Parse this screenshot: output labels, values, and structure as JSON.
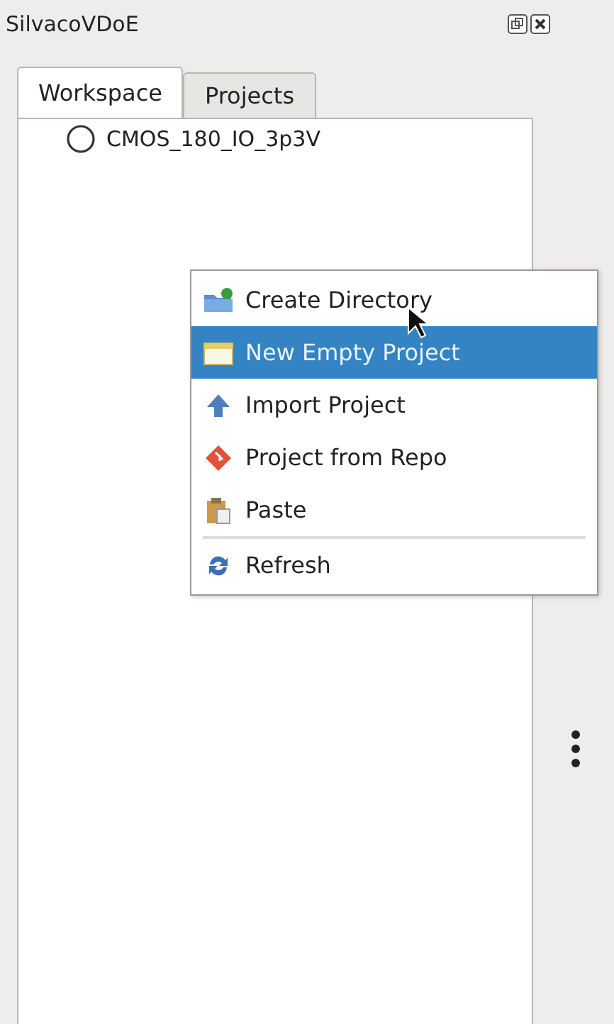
{
  "window": {
    "title": "SilvacoVDoE"
  },
  "tabs": [
    {
      "label": "Workspace",
      "selected": true
    },
    {
      "label": "Projects",
      "selected": false
    }
  ],
  "tree": {
    "items": [
      {
        "label": "CMOS_180_IO_3p3V",
        "selected": false
      }
    ]
  },
  "context_menu": {
    "items": [
      {
        "kind": "item",
        "label": "Create Directory",
        "selected": false
      },
      {
        "kind": "item",
        "label": "New Empty Project",
        "selected": true
      },
      {
        "kind": "item",
        "label": "Import Project",
        "selected": false
      },
      {
        "kind": "item",
        "label": "Project from Repo",
        "selected": false
      },
      {
        "kind": "item",
        "label": "Paste",
        "selected": false
      },
      {
        "kind": "separator"
      },
      {
        "kind": "item",
        "label": "Refresh",
        "selected": false
      }
    ]
  }
}
